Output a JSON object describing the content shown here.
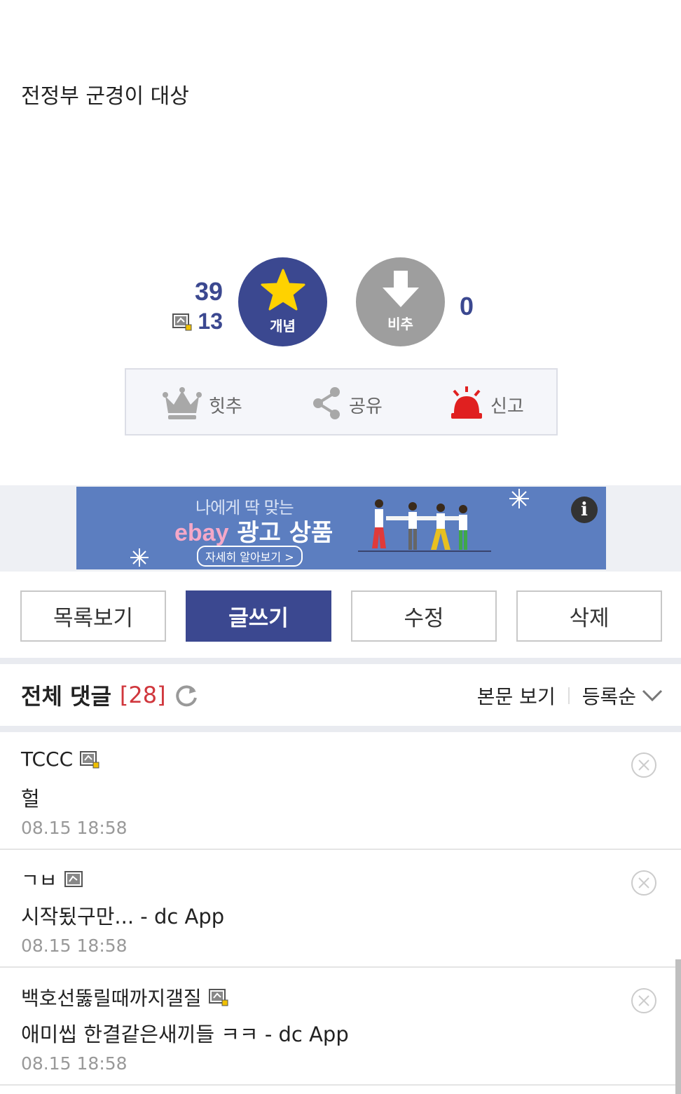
{
  "post": {
    "body": "전정부 군경이 대상"
  },
  "vote": {
    "up_count": "39",
    "fix_count": "13",
    "up_label": "개념",
    "down_label": "비추",
    "down_count": "0"
  },
  "actions": {
    "hit": "힛추",
    "share": "공유",
    "report": "신고"
  },
  "ad": {
    "line1": "나에게 딱 맞는",
    "brand": "ebay",
    "line2": "광고 상품",
    "cta": "자세히 알아보기 >",
    "info": "i"
  },
  "buttons": {
    "list": "목록보기",
    "write": "글쓰기",
    "edit": "수정",
    "delete": "삭제"
  },
  "comments_header": {
    "title": "전체 댓글",
    "count": "[28]",
    "view_body": "본문 보기",
    "sort": "등록순"
  },
  "comments": [
    {
      "nick": "TCCC",
      "text": "헐",
      "date": "08.15 18:58"
    },
    {
      "nick": "ㄱㅂ",
      "text": "시작됬구만... - dc App",
      "date": "08.15 18:58"
    },
    {
      "nick": "백호선뚫릴때까지갤질",
      "text": "애미씹 한결같은새끼들 ㅋㅋ - dc App",
      "date": "08.15 18:58"
    }
  ],
  "colors": {
    "accent": "#3b4890",
    "downvote": "#9e9e9e",
    "count_red": "#d0373d",
    "report_red": "#e02020"
  }
}
